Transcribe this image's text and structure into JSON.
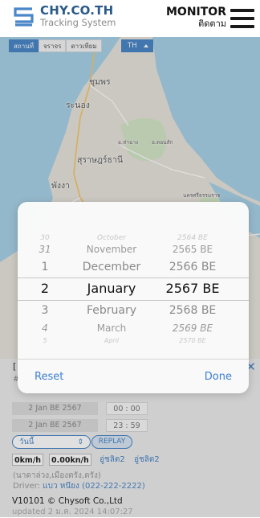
{
  "header": {
    "brand_name": "CHY.CO.TH",
    "brand_sub": "Tracking System",
    "monitor_en": "MONITOR",
    "monitor_th": "ติดตาม"
  },
  "map": {
    "tabs": [
      "สถานที่",
      "จราจร",
      "ดาวเทียม"
    ],
    "lang": "TH",
    "labels": {
      "chumphon": "ชุมพร",
      "ranong": "ระนอง",
      "surat": "สุราษฎร์ธานี",
      "phangnga": "พังงา",
      "small1": "อ.ท่าฉาง",
      "small2": "อ.ดอนสัก",
      "small3": "นครศรีธรรมราช"
    }
  },
  "picker": {
    "days": [
      "30",
      "31",
      "1",
      "2",
      "3",
      "4",
      "5"
    ],
    "months": [
      "October",
      "November",
      "December",
      "January",
      "February",
      "March",
      "April"
    ],
    "years": [
      "2564 BE",
      "2565 BE",
      "2566 BE",
      "2567 BE",
      "2568 BE",
      "2569 BE",
      "2570 BE"
    ],
    "reset_label": "Reset",
    "done_label": "Done"
  },
  "panel": {
    "title_prefix": "[",
    "subtitle_prefix": "#",
    "start_date": "2 Jan BE 2567",
    "start_time": "00 : 00",
    "end_date": "2 Jan BE 2567",
    "end_time": "23 : 59",
    "period_select": "วันนี้",
    "replay_label": "REPLAY",
    "speed1": "0km/h",
    "speed2": "0.00kn/h",
    "zone1": "อู่ชลิต2",
    "zone2": "อู่ชลิต2",
    "location_line": "(นาดาล่วง,เมืองตรัง,ตรัง)",
    "driver_label": "Driver:",
    "driver_value": "แบว หนึยง (022-222-2222)",
    "version": "V10101 © Chysoft Co.,Ltd",
    "updated": "updated    2 ม.ค. 2024 14:07:27"
  }
}
